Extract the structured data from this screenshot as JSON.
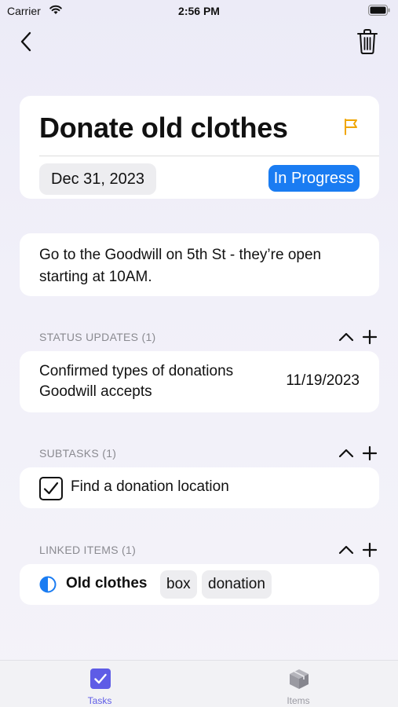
{
  "status_bar": {
    "carrier": "Carrier",
    "time": "2:56 PM"
  },
  "nav": {
    "back_icon": "chevron-left-icon",
    "trash_icon": "trash-icon"
  },
  "task": {
    "title": "Donate old clothes",
    "flag_icon": "flag-icon",
    "due_date": "Dec 31, 2023",
    "status": "In Progress",
    "notes": "Go to the Goodwill on 5th St - they’re open starting at 10AM."
  },
  "status_updates": {
    "header": "STATUS UPDATES (1)",
    "items": [
      {
        "text": "Confirmed types of donations Goodwill accepts",
        "date": "11/19/2023"
      }
    ]
  },
  "subtasks": {
    "header": "SUBTASKS (1)",
    "items": [
      {
        "label": "Find a donation location",
        "checked": true
      }
    ]
  },
  "linked_items": {
    "header": "LINKED ITEMS (1)",
    "items": [
      {
        "name": "Old clothes",
        "tags": [
          "box",
          "donation"
        ]
      }
    ]
  },
  "tabbar": {
    "tabs": [
      {
        "label": "Tasks",
        "icon": "checkbox-icon",
        "active": true
      },
      {
        "label": "Items",
        "icon": "cube-icon",
        "active": false
      }
    ]
  },
  "colors": {
    "accent": "#1a7cf2",
    "flag": "#f0a500",
    "tab_active": "#5e5ce6",
    "tab_inactive": "#9a9aa2"
  }
}
